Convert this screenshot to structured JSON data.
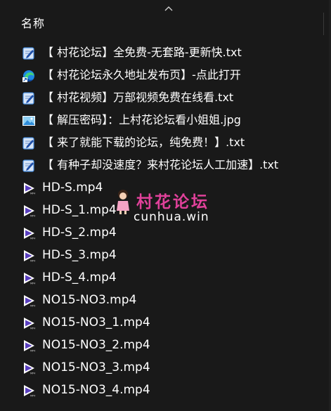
{
  "header": {
    "column_name_label": "名称"
  },
  "files": [
    {
      "name": "【 村花论坛】全免费-无套路-更新快.txt",
      "icon": "text-file-icon",
      "type": "text"
    },
    {
      "name": "【 村花论坛永久地址发布页】-点此打开",
      "icon": "edge-shortcut-icon",
      "type": "shortcut"
    },
    {
      "name": "【 村花视频】万部视频免费在线看.txt",
      "icon": "text-file-icon",
      "type": "text"
    },
    {
      "name": "【 解压密码】：上村花论坛看小姐姐.jpg",
      "icon": "image-file-icon",
      "type": "image"
    },
    {
      "name": "【 来了就能下载的论坛，纯免费！】.txt",
      "icon": "text-file-icon",
      "type": "text"
    },
    {
      "name": "【 有种子却没速度？来村花论坛人工加速】.txt",
      "icon": "text-file-icon",
      "type": "text"
    },
    {
      "name": "HD-S.mp4",
      "icon": "video-file-icon",
      "type": "video"
    },
    {
      "name": "HD-S_1.mp4",
      "icon": "video-file-icon",
      "type": "video"
    },
    {
      "name": "HD-S_2.mp4",
      "icon": "video-file-icon",
      "type": "video"
    },
    {
      "name": "HD-S_3.mp4",
      "icon": "video-file-icon",
      "type": "video"
    },
    {
      "name": "HD-S_4.mp4",
      "icon": "video-file-icon",
      "type": "video"
    },
    {
      "name": "NO15-NO3.mp4",
      "icon": "video-file-icon",
      "type": "video"
    },
    {
      "name": "NO15-NO3_1.mp4",
      "icon": "video-file-icon",
      "type": "video"
    },
    {
      "name": "NO15-NO3_2.mp4",
      "icon": "video-file-icon",
      "type": "video"
    },
    {
      "name": "NO15-NO3_3.mp4",
      "icon": "video-file-icon",
      "type": "video"
    },
    {
      "name": "NO15-NO3_4.mp4",
      "icon": "video-file-icon",
      "type": "video"
    }
  ],
  "watermark": {
    "title": "村花论坛",
    "url": "cunhua.win"
  },
  "colors": {
    "background": "#191919",
    "text": "#ffffff",
    "watermark_pink": "#e0419a",
    "video_icon_purple": "#5a3fc0"
  }
}
